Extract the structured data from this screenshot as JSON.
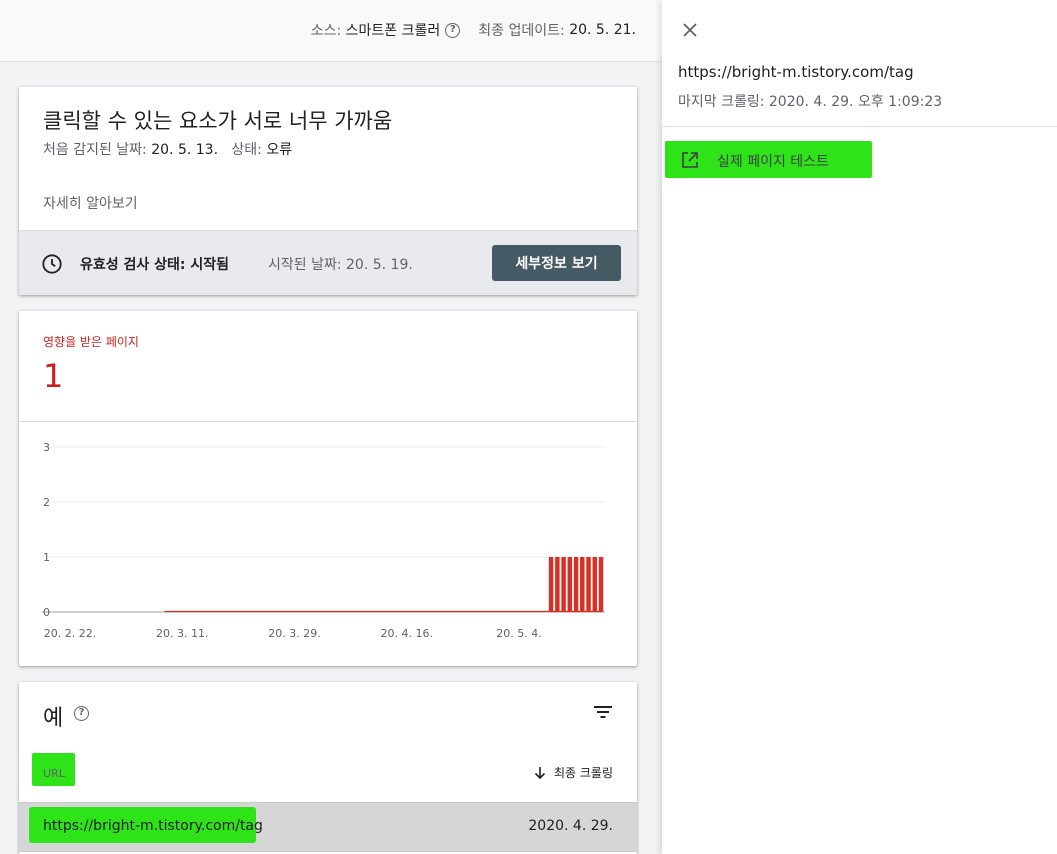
{
  "topbar": {
    "source_label": "소스:",
    "source_value": "스마트폰 크롤러",
    "updated_label": "최종 업데이트:",
    "updated_value": "20. 5. 21."
  },
  "issue": {
    "title": "클릭할 수 있는 요소가 서로 너무 가까움",
    "first_detected_label": "처음 감지된 날짜:",
    "first_detected_value": "20. 5. 13.",
    "status_label": "상태:",
    "status_value": "오류",
    "learn_more": "자세히 알아보기",
    "validation_status": "유효성 검사 상태: 시작됨",
    "validation_started": "시작된 날짜: 20. 5. 19.",
    "details_button": "세부정보 보기"
  },
  "affected": {
    "label": "영향을 받은 페이지",
    "count": "1"
  },
  "chart_data": {
    "type": "bar",
    "ylim": [
      0,
      3
    ],
    "yticks": [
      "0",
      "1",
      "2",
      "3"
    ],
    "xtick_labels": [
      "20. 2. 22.",
      "20. 3. 11.",
      "20. 3. 29.",
      "20. 4. 16.",
      "20. 5. 4."
    ],
    "x_dates": [
      "20. 2. 22.",
      "20. 2. 23.",
      "20. 2. 24.",
      "20. 2. 25.",
      "20. 2. 26.",
      "20. 2. 27.",
      "20. 2. 28.",
      "20. 2. 29.",
      "20. 3. 1.",
      "20. 3. 2.",
      "20. 3. 3.",
      "20. 3. 4.",
      "20. 3. 5.",
      "20. 3. 6.",
      "20. 3. 7.",
      "20. 3. 8.",
      "20. 3. 9.",
      "20. 3. 10.",
      "20. 3. 11.",
      "20. 3. 12.",
      "20. 3. 13.",
      "20. 3. 14.",
      "20. 3. 15.",
      "20. 3. 16.",
      "20. 3. 17.",
      "20. 3. 18.",
      "20. 3. 19.",
      "20. 3. 20.",
      "20. 3. 21.",
      "20. 3. 22.",
      "20. 3. 23.",
      "20. 3. 24.",
      "20. 3. 25.",
      "20. 3. 26.",
      "20. 3. 27.",
      "20. 3. 28.",
      "20. 3. 29.",
      "20. 3. 30.",
      "20. 3. 31.",
      "20. 4. 1.",
      "20. 4. 2.",
      "20. 4. 3.",
      "20. 4. 4.",
      "20. 4. 5.",
      "20. 4. 6.",
      "20. 4. 7.",
      "20. 4. 8.",
      "20. 4. 9.",
      "20. 4. 10.",
      "20. 4. 11.",
      "20. 4. 12.",
      "20. 4. 13.",
      "20. 4. 14.",
      "20. 4. 15.",
      "20. 4. 16.",
      "20. 4. 17.",
      "20. 4. 18.",
      "20. 4. 19.",
      "20. 4. 20.",
      "20. 4. 21.",
      "20. 4. 22.",
      "20. 4. 23.",
      "20. 4. 24.",
      "20. 4. 25.",
      "20. 4. 26.",
      "20. 4. 27.",
      "20. 4. 28.",
      "20. 4. 29.",
      "20. 4. 30.",
      "20. 5. 1.",
      "20. 5. 2.",
      "20. 5. 3.",
      "20. 5. 4.",
      "20. 5. 5.",
      "20. 5. 6.",
      "20. 5. 7.",
      "20. 5. 8.",
      "20. 5. 9.",
      "20. 5. 10.",
      "20. 5. 11.",
      "20. 5. 12.",
      "20. 5. 13.",
      "20. 5. 14.",
      "20. 5. 15.",
      "20. 5. 16.",
      "20. 5. 17.",
      "20. 5. 18.",
      "20. 5. 19.",
      "20. 5. 20.",
      "20. 5. 21."
    ],
    "values": [
      null,
      null,
      null,
      null,
      null,
      null,
      null,
      null,
      null,
      null,
      null,
      null,
      null,
      null,
      null,
      null,
      null,
      null,
      null,
      0,
      0,
      0,
      0,
      0,
      0,
      0,
      0,
      0,
      0,
      0,
      0,
      0,
      0,
      0,
      0,
      0,
      0,
      0,
      0,
      0,
      0,
      0,
      0,
      0,
      0,
      0,
      0,
      0,
      0,
      0,
      0,
      0,
      0,
      0,
      0,
      0,
      0,
      0,
      0,
      0,
      0,
      0,
      0,
      0,
      0,
      0,
      0,
      0,
      0,
      0,
      0,
      0,
      0,
      0,
      0,
      0,
      0,
      0,
      0,
      0,
      0,
      1,
      1,
      1,
      1,
      1,
      1,
      1,
      1,
      1
    ],
    "grid": true,
    "color": "#d93025"
  },
  "examples": {
    "title": "예",
    "col_url": "URL",
    "col_crawl": "최종 크롤링",
    "rows": [
      {
        "url": "https://bright-m.tistory.com/tag",
        "date": "2020. 4. 29."
      }
    ]
  },
  "panel": {
    "url": "https://bright-m.tistory.com/tag",
    "last_crawl": "마지막 크롤링: 2020. 4. 29. 오후 1:09:23",
    "live_test": "실제 페이지 테스트"
  },
  "colors": {
    "accent_red": "#d93025",
    "button_bg": "#455a64",
    "highlight": "#2ee317"
  },
  "icons": {
    "help": "help-circle-icon",
    "clock": "clock-icon",
    "filter": "filter-icon",
    "sort": "arrow-down-icon",
    "close": "close-icon",
    "external": "open-in-new-icon"
  }
}
